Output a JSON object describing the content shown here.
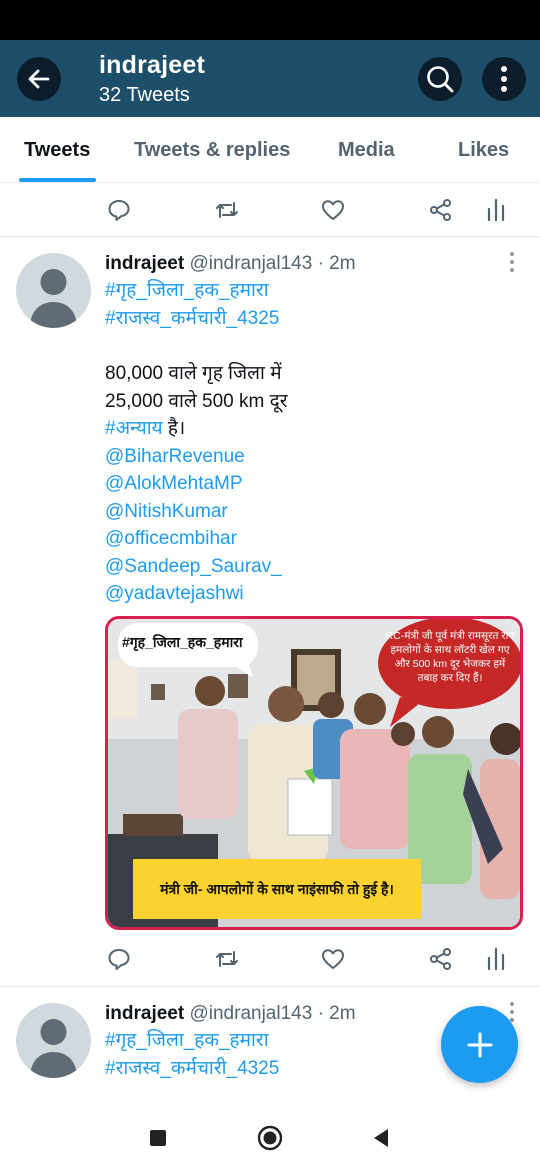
{
  "header": {
    "title": "indrajeet",
    "subtitle": "32 Tweets"
  },
  "tabs": [
    {
      "label": "Tweets",
      "active": true
    },
    {
      "label": "Tweets & replies",
      "active": false
    },
    {
      "label": "Media",
      "active": false
    },
    {
      "label": "Likes",
      "active": false
    }
  ],
  "tweets": [
    {
      "name": "indrajeet",
      "meta": "@indranjal143 · 2m",
      "lines": [
        {
          "text": "#गृह_जिला_हक_हमारा",
          "type": "link"
        },
        {
          "text": "#राजस्व_कर्मचारी_4325",
          "type": "link"
        },
        {
          "text": "80,000 वाले गृह जिला में",
          "type": "plain"
        },
        {
          "text": "25,000 वाले 500 km दूर",
          "type": "plain"
        },
        {
          "link": "#अन्याय",
          "rest": " है।",
          "type": "mixed"
        },
        {
          "text": "@BiharRevenue",
          "type": "link"
        },
        {
          "text": "@AlokMehtaMP",
          "type": "link"
        },
        {
          "text": "@NitishKumar",
          "type": "link"
        },
        {
          "text": "@officecmbihar",
          "type": "link"
        },
        {
          "text": "@Sandeep_Saurav_",
          "type": "link"
        },
        {
          "text": "@yadavtejashwi",
          "type": "link"
        }
      ],
      "media": {
        "bubble_left": "#गृह_जिला_हक_हमारा",
        "bubble_right": "RC-मंत्री जी पूर्व मंत्री रामसूरत राय हमलोगों के साथ लॉटरी खेल गए और 500 km दूर भेजकर हमें तबाह कर दिए हैं।",
        "caption": "मंत्री जी- आपलोगों के साथ नाइंसाफी तो हुई है।"
      }
    },
    {
      "name": "indrajeet",
      "meta": "@indranjal143 · 2m",
      "lines": [
        {
          "text": "#गृह_जिला_हक_हमारा",
          "type": "link"
        },
        {
          "text": "#राजस्व_कर्मचारी_4325",
          "type": "link"
        }
      ]
    }
  ],
  "icons": {
    "back": "arrow-left-icon",
    "search": "search-icon",
    "more": "more-vertical-icon",
    "reply": "reply-icon",
    "retweet": "retweet-icon",
    "like": "heart-icon",
    "share": "share-icon",
    "analytics": "analytics-icon",
    "compose": "plus-icon"
  },
  "colors": {
    "header_bg": "#1d4f6b",
    "accent": "#1d9bf0",
    "text": "#0f1419",
    "muted": "#536471"
  }
}
